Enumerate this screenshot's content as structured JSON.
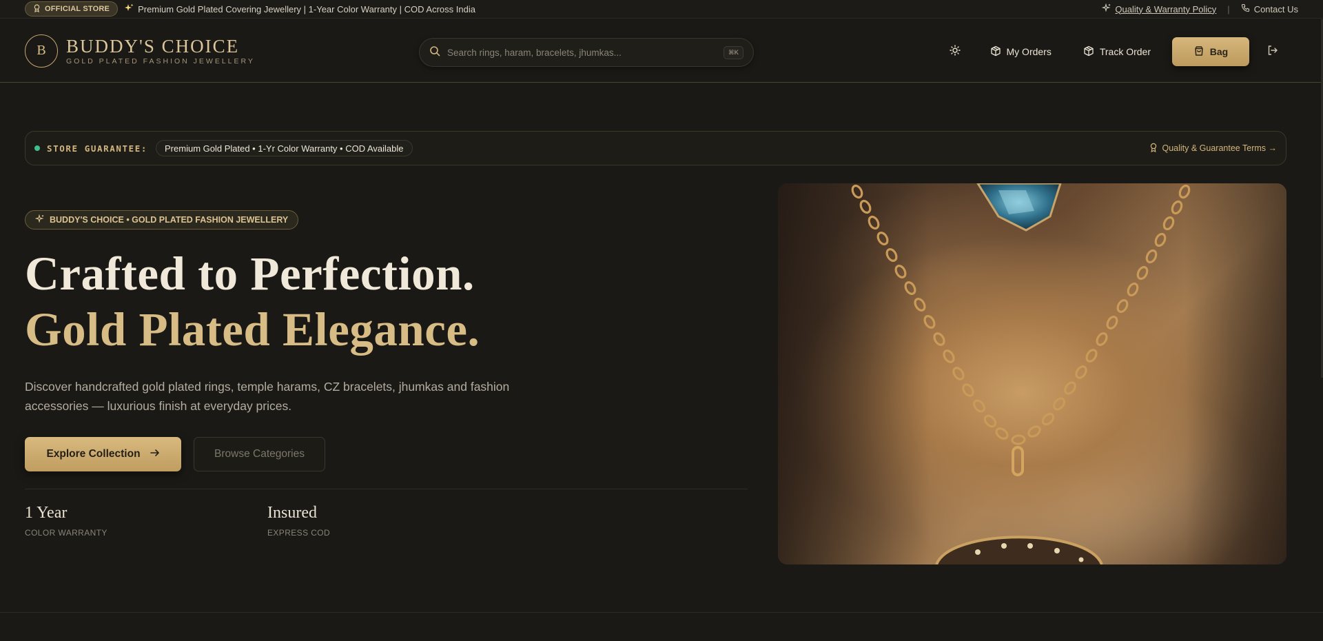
{
  "topbar": {
    "official_badge": "OFFICIAL STORE",
    "announcement": "Premium Gold Plated Covering Jewellery | 1-Year Color Warranty | COD Across India",
    "policy_link": "Quality & Warranty Policy",
    "separator": "|",
    "contact_link": "Contact Us"
  },
  "header": {
    "logo_letter": "B",
    "brand_name": "BUDDY'S CHOICE",
    "brand_tagline": "GOLD PLATED FASHION JEWELLERY",
    "search": {
      "placeholder": "Search rings, haram, bracelets, jhumkas...",
      "value": "",
      "shortcut": "⌘K"
    },
    "my_orders": "My Orders",
    "track_order": "Track Order",
    "bag": "Bag"
  },
  "guarantee": {
    "label": "STORE GUARANTEE:",
    "pill": "Premium Gold Plated • 1-Yr Color Warranty • COD Available",
    "terms_link": "Quality & Guarantee Terms →"
  },
  "hero": {
    "badge": "BUDDY'S CHOICE • GOLD PLATED FASHION JEWELLERY",
    "headline_line1": "Crafted to Perfection.",
    "headline_line2": "Gold Plated Elegance.",
    "description": "Discover handcrafted gold plated rings, temple harams, CZ bracelets, jhumkas and fashion accessories — luxurious finish at everyday prices.",
    "primary_cta": "Explore Collection",
    "secondary_cta": "Browse Categories",
    "stats": [
      {
        "value": "1 Year",
        "label": "COLOR WARRANTY"
      },
      {
        "value": "Insured",
        "label": "EXPRESS COD"
      }
    ]
  },
  "colors": {
    "background": "#1a1915",
    "gold_accent": "#d8bc86",
    "status_green": "#3fbf8d"
  },
  "icons": {
    "official_badge": "award-icon",
    "announcement": "sparkles-icon",
    "policy": "sparkle-icon",
    "contact": "phone-icon",
    "search": "search-icon",
    "theme": "sun-icon",
    "orders": "package-icon",
    "track": "package-icon",
    "bag": "shopping-bag-icon",
    "logout": "log-out-icon",
    "terms": "award-icon",
    "cta": "arrow-right-icon"
  }
}
